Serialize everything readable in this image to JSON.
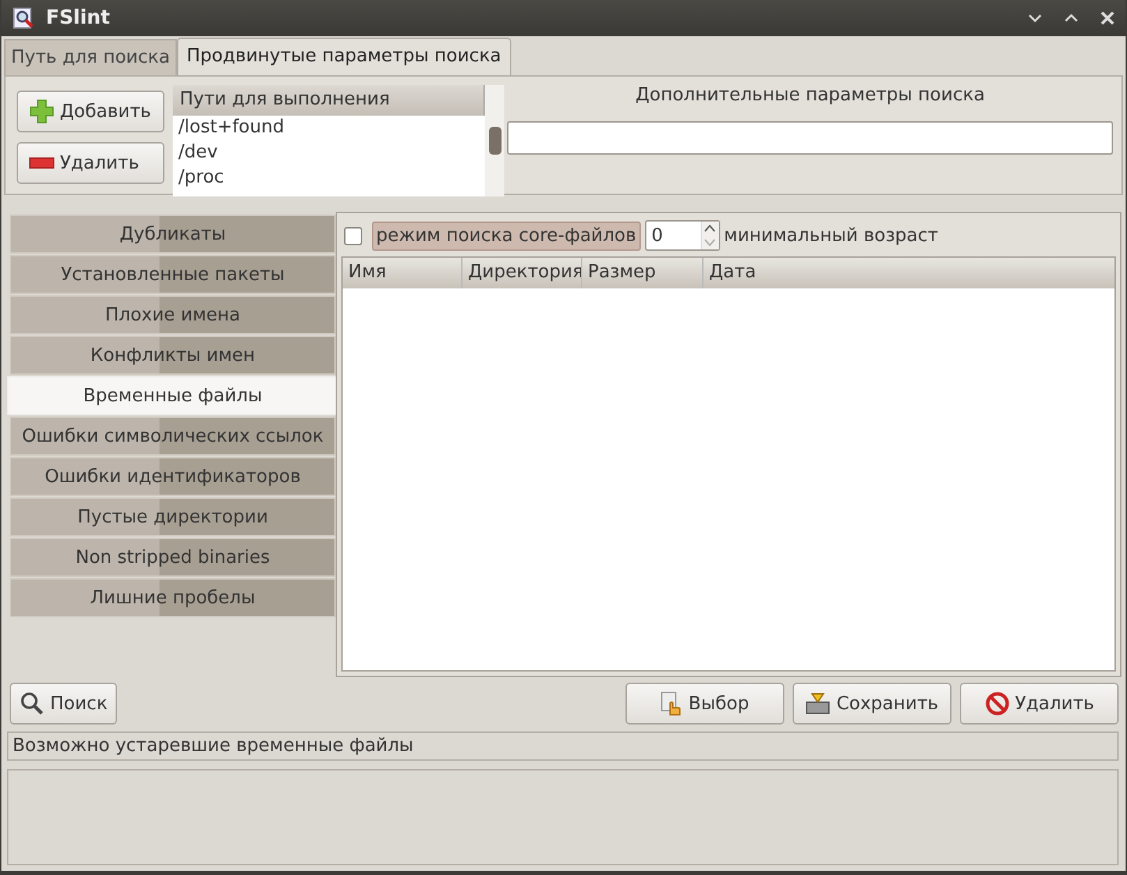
{
  "window": {
    "title": "FSlint"
  },
  "tabs": [
    {
      "label": "Путь для поиска",
      "selected": false
    },
    {
      "label": "Продвинутые параметры поиска",
      "selected": true
    }
  ],
  "paths": {
    "add_button": "Добавить",
    "remove_button": "Удалить",
    "column": "Пути для выполнения",
    "items": [
      "/lost+found",
      "/dev",
      "/proc"
    ]
  },
  "extra": {
    "label": "Дополнительные параметры поиска"
  },
  "sidebar": {
    "items": [
      {
        "label": "Дубликаты",
        "selected": false
      },
      {
        "label": "Установленные пакеты",
        "selected": false
      },
      {
        "label": "Плохие имена",
        "selected": false
      },
      {
        "label": "Конфликты имен",
        "selected": false
      },
      {
        "label": "Временные файлы",
        "selected": true
      },
      {
        "label": "Ошибки символических ссылок",
        "selected": false
      },
      {
        "label": "Ошибки идентификаторов",
        "selected": false
      },
      {
        "label": "Пустые директории",
        "selected": false
      },
      {
        "label": "Non stripped binaries",
        "selected": false
      },
      {
        "label": "Лишние пробелы",
        "selected": false
      }
    ]
  },
  "options": {
    "core_mode": {
      "label": "режим поиска core-файлов",
      "checked": false
    },
    "min_age": {
      "value": "0",
      "label": "минимальный возраст"
    }
  },
  "table": {
    "columns": [
      "Имя",
      "Директория",
      "Размер",
      "Дата"
    ]
  },
  "buttons": {
    "search": "Поиск",
    "select": "Выбор",
    "save": "Сохранить",
    "delete": "Удалить"
  },
  "status_bar": "Возможно устаревшие временные файлы"
}
